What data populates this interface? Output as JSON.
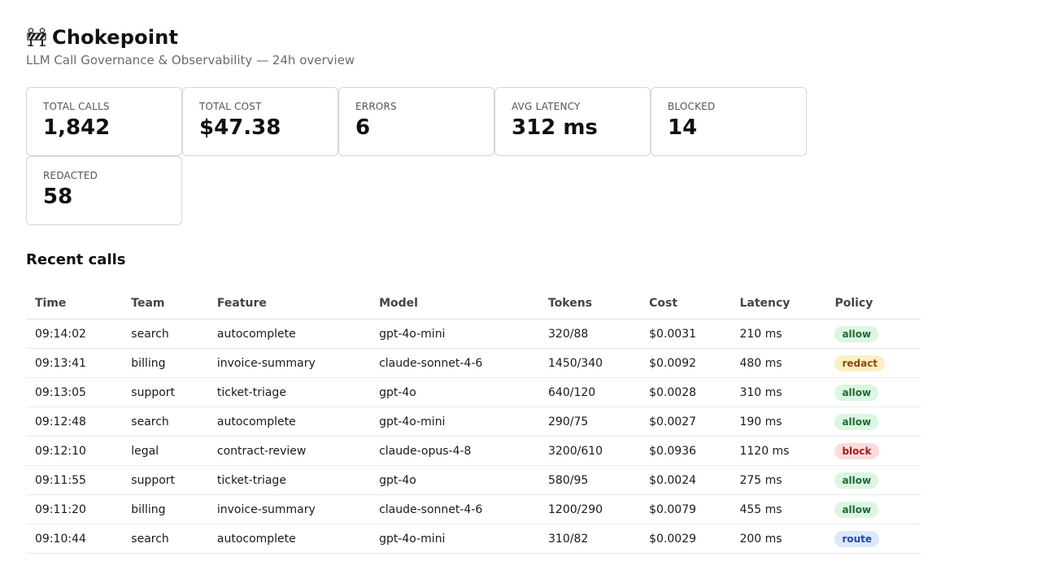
{
  "app": {
    "title": "Chokepoint",
    "subtitle": "LLM Call Governance & Observability — 24h overview",
    "logo_icon": "construction-barrier-icon"
  },
  "stats": [
    {
      "label": "TOTAL CALLS",
      "value": "1,842"
    },
    {
      "label": "TOTAL COST",
      "value": "$47.38"
    },
    {
      "label": "ERRORS",
      "value": "6"
    },
    {
      "label": "AVG LATENCY",
      "value": "312 ms"
    },
    {
      "label": "BLOCKED",
      "value": "14"
    },
    {
      "label": "REDACTED",
      "value": "58"
    }
  ],
  "recent": {
    "title": "Recent calls",
    "columns": [
      "Time",
      "Team",
      "Feature",
      "Model",
      "Tokens",
      "Cost",
      "Latency",
      "Policy"
    ],
    "rows": [
      {
        "time": "09:14:02",
        "team": "search",
        "feature": "autocomplete",
        "model": "gpt-4o-mini",
        "tokens": "320/88",
        "cost": "$0.0031",
        "latency": "210 ms",
        "policy": "allow"
      },
      {
        "time": "09:13:41",
        "team": "billing",
        "feature": "invoice-summary",
        "model": "claude-sonnet-4-6",
        "tokens": "1450/340",
        "cost": "$0.0092",
        "latency": "480 ms",
        "policy": "redact"
      },
      {
        "time": "09:13:05",
        "team": "support",
        "feature": "ticket-triage",
        "model": "gpt-4o",
        "tokens": "640/120",
        "cost": "$0.0028",
        "latency": "310 ms",
        "policy": "allow"
      },
      {
        "time": "09:12:48",
        "team": "search",
        "feature": "autocomplete",
        "model": "gpt-4o-mini",
        "tokens": "290/75",
        "cost": "$0.0027",
        "latency": "190 ms",
        "policy": "allow"
      },
      {
        "time": "09:12:10",
        "team": "legal",
        "feature": "contract-review",
        "model": "claude-opus-4-8",
        "tokens": "3200/610",
        "cost": "$0.0936",
        "latency": "1120 ms",
        "policy": "block"
      },
      {
        "time": "09:11:55",
        "team": "support",
        "feature": "ticket-triage",
        "model": "gpt-4o",
        "tokens": "580/95",
        "cost": "$0.0024",
        "latency": "275 ms",
        "policy": "allow"
      },
      {
        "time": "09:11:20",
        "team": "billing",
        "feature": "invoice-summary",
        "model": "claude-sonnet-4-6",
        "tokens": "1200/290",
        "cost": "$0.0079",
        "latency": "455 ms",
        "policy": "allow"
      },
      {
        "time": "09:10:44",
        "team": "search",
        "feature": "autocomplete",
        "model": "gpt-4o-mini",
        "tokens": "310/82",
        "cost": "$0.0029",
        "latency": "200 ms",
        "policy": "route"
      }
    ]
  },
  "colors": {
    "allow": "#1f6b34",
    "redact": "#8a4a0a",
    "block": "#9c1f1f",
    "route": "#1f4aa0"
  }
}
